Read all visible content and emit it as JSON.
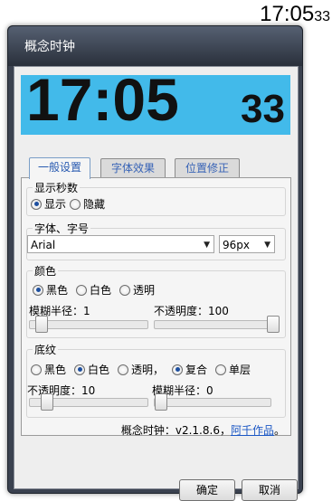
{
  "desktop_clock": {
    "main": "17:05",
    "seconds": "33"
  },
  "window": {
    "title": "概念时钟"
  },
  "preview": {
    "main": "17:05",
    "seconds": "33",
    "background_color": "#42baea"
  },
  "tabs": [
    {
      "label": "一般设置",
      "active": true
    },
    {
      "label": "字体效果",
      "active": false
    },
    {
      "label": "位置修正",
      "active": false
    }
  ],
  "seconds_group": {
    "legend": "显示秒数",
    "options": [
      {
        "label": "显示",
        "checked": true
      },
      {
        "label": "隐藏",
        "checked": false
      }
    ]
  },
  "font_group": {
    "legend": "字体、字号",
    "font_value": "Arial",
    "size_value": "96px"
  },
  "color_group": {
    "legend": "颜色",
    "options": [
      {
        "label": "黑色",
        "checked": true
      },
      {
        "label": "白色",
        "checked": false
      },
      {
        "label": "透明",
        "checked": false
      }
    ],
    "blur_label": "模糊半径：1",
    "blur_value": 0.05,
    "opacity_label": "不透明度：100",
    "opacity_value": 1.0
  },
  "bg_group": {
    "legend": "底纹",
    "color_options": [
      {
        "label": "黑色",
        "checked": false
      },
      {
        "label": "白色",
        "checked": true
      },
      {
        "label": "透明，",
        "checked": false
      }
    ],
    "mode_options": [
      {
        "label": "复合",
        "checked": true
      },
      {
        "label": "单层",
        "checked": false
      }
    ],
    "opacity_label": "不透明度：10",
    "opacity_value": 0.1,
    "blur_label": "模糊半径：0",
    "blur_value": 0.0
  },
  "footer": {
    "version_text": "概念时钟：v2.1.8.6，",
    "link_text": "阿千作品",
    "period": "。"
  },
  "buttons": {
    "ok": "确定",
    "cancel": "取消"
  }
}
